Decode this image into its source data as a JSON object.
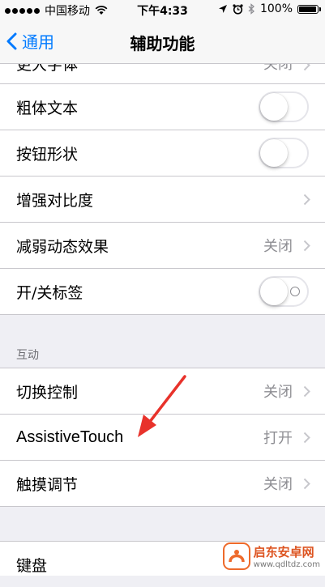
{
  "status_bar": {
    "carrier": "中国移动",
    "time": "下午4:33",
    "battery": "100%",
    "battery_level": 1.0
  },
  "nav": {
    "back_label": "通用",
    "title": "辅助功能"
  },
  "sections": {
    "vision_rows": [
      {
        "label": "更大字体",
        "value": "关闭",
        "type": "disclosure",
        "partial": true
      },
      {
        "label": "粗体文本",
        "type": "toggle",
        "on": false
      },
      {
        "label": "按钮形状",
        "type": "toggle",
        "on": false
      },
      {
        "label": "增强对比度",
        "type": "disclosure"
      },
      {
        "label": "减弱动态效果",
        "value": "关闭",
        "type": "disclosure"
      },
      {
        "label": "开/关标签",
        "type": "toggle",
        "on": false,
        "labels": true
      }
    ],
    "interaction_header": "互动",
    "interaction_rows": [
      {
        "label": "切换控制",
        "value": "关闭"
      },
      {
        "label": "AssistiveTouch",
        "value": "打开"
      },
      {
        "label": "触摸调节",
        "value": "关闭"
      }
    ],
    "keyboard_row": {
      "label": "键盘"
    }
  },
  "watermark": {
    "name": "启东安卓网",
    "url": "www.qdltdz.com"
  },
  "colors": {
    "accent": "#007aff",
    "annotation_arrow": "#e8322b"
  },
  "icons": [
    "wifi-icon",
    "location-icon",
    "alarm-icon",
    "bluetooth-icon",
    "battery-icon",
    "chevron-left-icon",
    "chevron-right-icon"
  ]
}
